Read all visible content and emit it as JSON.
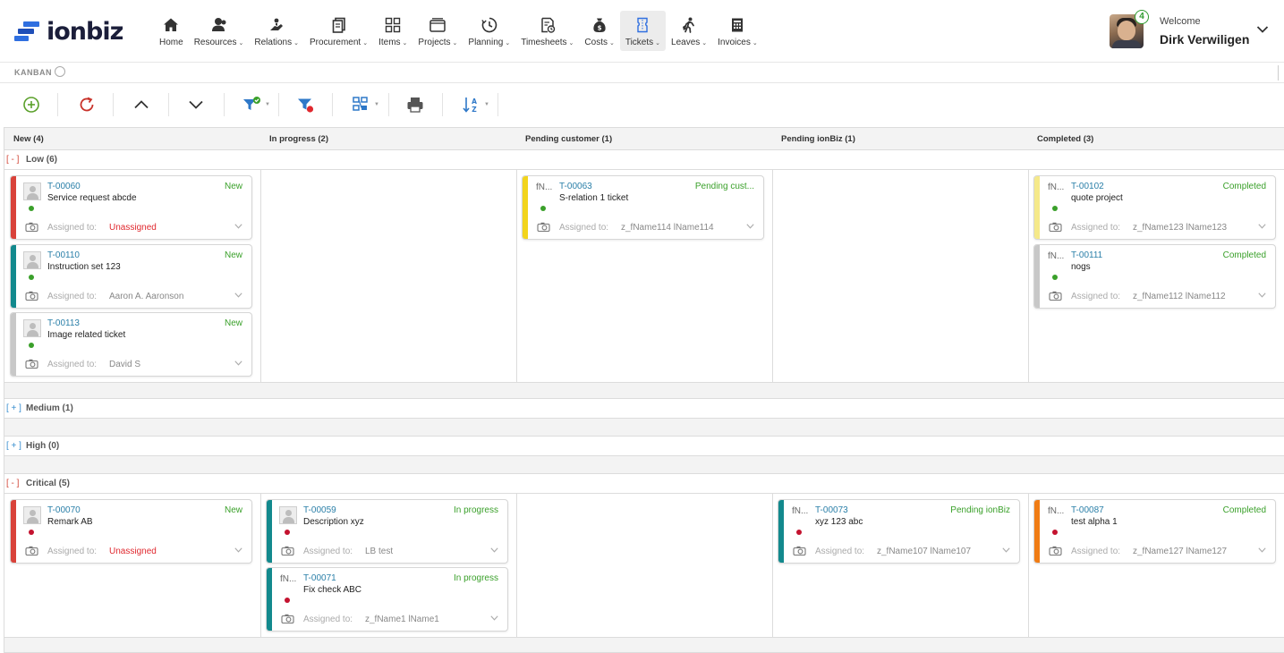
{
  "app": {
    "logo_text": "ionbiz"
  },
  "nav": [
    {
      "label": "Home",
      "icon": "home-icon",
      "dropdown": false
    },
    {
      "label": "Resources",
      "icon": "users-icon",
      "dropdown": true
    },
    {
      "label": "Relations",
      "icon": "handshake-icon",
      "dropdown": true
    },
    {
      "label": "Procurement",
      "icon": "documents-icon",
      "dropdown": true
    },
    {
      "label": "Items",
      "icon": "grid-icon",
      "dropdown": true
    },
    {
      "label": "Projects",
      "icon": "folder-icon",
      "dropdown": true
    },
    {
      "label": "Planning",
      "icon": "clock-icon",
      "dropdown": true
    },
    {
      "label": "Timesheets",
      "icon": "timesheet-icon",
      "dropdown": true
    },
    {
      "label": "Costs",
      "icon": "money-bag-icon",
      "dropdown": true
    },
    {
      "label": "Tickets",
      "icon": "ticket-icon",
      "dropdown": true,
      "active": true
    },
    {
      "label": "Leaves",
      "icon": "walking-icon",
      "dropdown": true
    },
    {
      "label": "Invoices",
      "icon": "invoice-icon",
      "dropdown": true
    }
  ],
  "user": {
    "welcome": "Welcome",
    "name": "Dirk Verwiligen",
    "notifications": "4"
  },
  "breadcrumb": {
    "label": "KANBAN"
  },
  "columns": [
    {
      "label": "New (4)"
    },
    {
      "label": "In progress (2)"
    },
    {
      "label": "Pending customer (1)"
    },
    {
      "label": "Pending ionBiz (1)"
    },
    {
      "label": "Completed (3)"
    }
  ],
  "lanes": [
    {
      "toggle": "[ - ]",
      "label": "Low (6)",
      "expanded": true
    },
    {
      "toggle": "[ + ]",
      "label": "Medium (1)",
      "expanded": false
    },
    {
      "toggle": "[ + ]",
      "label": "High (0)",
      "expanded": false
    },
    {
      "toggle": "[ - ]",
      "label": "Critical (5)",
      "expanded": true
    }
  ],
  "assigned_label": "Assigned to:",
  "cards": [
    {
      "id": "T-00060",
      "title": "Service request abcde",
      "status": "New",
      "assignee": "Unassigned",
      "unassigned": true,
      "photo": true,
      "short": "",
      "bar": "#d9423a",
      "dot": "#3aa02a"
    },
    {
      "id": "T-00110",
      "title": "Instruction set 123",
      "status": "New",
      "assignee": "Aaron A. Aaronson",
      "unassigned": false,
      "photo": true,
      "short": "",
      "bar": "#12898d",
      "dot": "#3aa02a"
    },
    {
      "id": "T-00113",
      "title": "Image related ticket",
      "status": "New",
      "assignee": "David S",
      "unassigned": false,
      "photo": true,
      "short": "",
      "bar": "#c8c8c8",
      "dot": "#3aa02a"
    },
    {
      "id": "T-00063",
      "title": "S-relation 1 ticket",
      "status": "Pending cust...",
      "assignee": "z_fName114 lName114",
      "unassigned": false,
      "photo": false,
      "short": "fN...",
      "bar": "#f2d41c",
      "dot": "#3aa02a"
    },
    {
      "id": "T-00102",
      "title": "quote project",
      "status": "Completed",
      "assignee": "z_fName123 lName123",
      "unassigned": false,
      "photo": false,
      "short": "fN...",
      "bar": "#f5e98a",
      "dot": "#3aa02a"
    },
    {
      "id": "T-00111",
      "title": "nogs",
      "status": "Completed",
      "assignee": "z_fName112 lName112",
      "unassigned": false,
      "photo": false,
      "short": "fN...",
      "bar": "#c8c8c8",
      "dot": "#3aa02a"
    },
    {
      "id": "T-00070",
      "title": "Remark AB",
      "status": "New",
      "assignee": "Unassigned",
      "unassigned": true,
      "photo": true,
      "short": "",
      "bar": "#d9423a",
      "dot": "#c4122f"
    },
    {
      "id": "T-00059",
      "title": "Description xyz",
      "status": "In progress",
      "assignee": "LB test",
      "unassigned": false,
      "photo": true,
      "short": "",
      "bar": "#12898d",
      "dot": "#c4122f"
    },
    {
      "id": "T-00071",
      "title": "Fix check ABC",
      "status": "In progress",
      "assignee": "z_fName1 lName1",
      "unassigned": false,
      "photo": false,
      "short": "fN...",
      "bar": "#12898d",
      "dot": "#c4122f"
    },
    {
      "id": "T-00073",
      "title": "xyz 123 abc",
      "status": "Pending ionBiz",
      "assignee": "z_fName107 lName107",
      "unassigned": false,
      "photo": false,
      "short": "fN...",
      "bar": "#12898d",
      "dot": "#c4122f"
    },
    {
      "id": "T-00087",
      "title": "test alpha 1",
      "status": "Completed",
      "assignee": "z_fName127 lName127",
      "unassigned": false,
      "photo": false,
      "short": "fN...",
      "bar": "#f07c14",
      "dot": "#c4122f"
    }
  ],
  "toolbar": [
    {
      "name": "add-button",
      "icon": "plus-circle-icon"
    },
    {
      "name": "refresh-button",
      "icon": "refresh-icon"
    },
    {
      "name": "collapse-all-button",
      "icon": "chevron-up-icon"
    },
    {
      "name": "expand-all-button",
      "icon": "chevron-down-icon"
    },
    {
      "name": "filter-button",
      "icon": "filter-check-icon"
    },
    {
      "name": "clear-filter-button",
      "icon": "filter-clear-icon"
    },
    {
      "name": "group-button",
      "icon": "group-icon"
    },
    {
      "name": "print-button",
      "icon": "printer-icon"
    },
    {
      "name": "sort-button",
      "icon": "sort-az-icon"
    }
  ]
}
